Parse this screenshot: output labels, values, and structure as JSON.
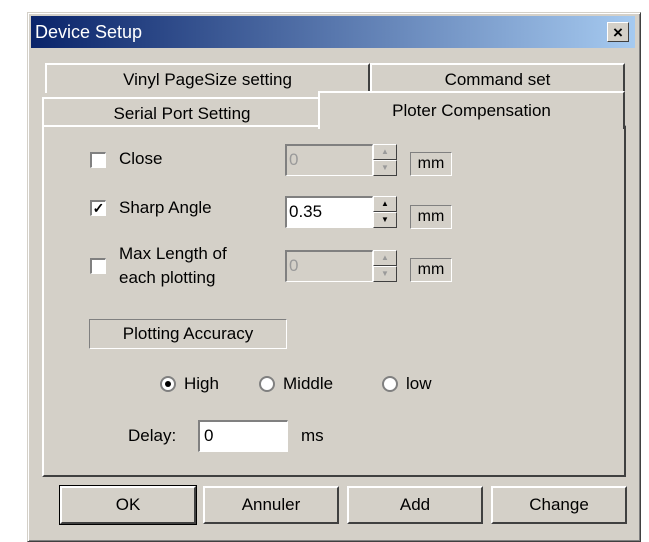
{
  "window": {
    "title": "Device Setup",
    "close_label": "×"
  },
  "tabs": {
    "back_row": [
      "Vinyl PageSize setting",
      "Command set"
    ],
    "front_row": [
      "Serial Port Setting",
      "Ploter Compensation"
    ],
    "active": "Ploter Compensation"
  },
  "options": [
    {
      "label": "Close",
      "checked": false,
      "value": "0",
      "enabled": false,
      "unit": "mm"
    },
    {
      "label": "Sharp Angle",
      "checked": true,
      "value": "0.35",
      "enabled": true,
      "unit": "mm"
    },
    {
      "label_line1": "Max Length of",
      "label_line2": "each plotting",
      "checked": false,
      "value": "0",
      "enabled": false,
      "unit": "mm"
    }
  ],
  "accuracy": {
    "title": "Plotting Accuracy",
    "options": [
      "High",
      "Middle",
      "low"
    ],
    "selected": "High"
  },
  "delay": {
    "label": "Delay:",
    "value": "0",
    "unit": "ms"
  },
  "buttons": {
    "ok": "OK",
    "cancel": "Annuler",
    "add": "Add",
    "change": "Change"
  },
  "colors": {
    "face": "#d4d0c8",
    "title_start": "#0a246a",
    "title_end": "#a6caf0"
  }
}
